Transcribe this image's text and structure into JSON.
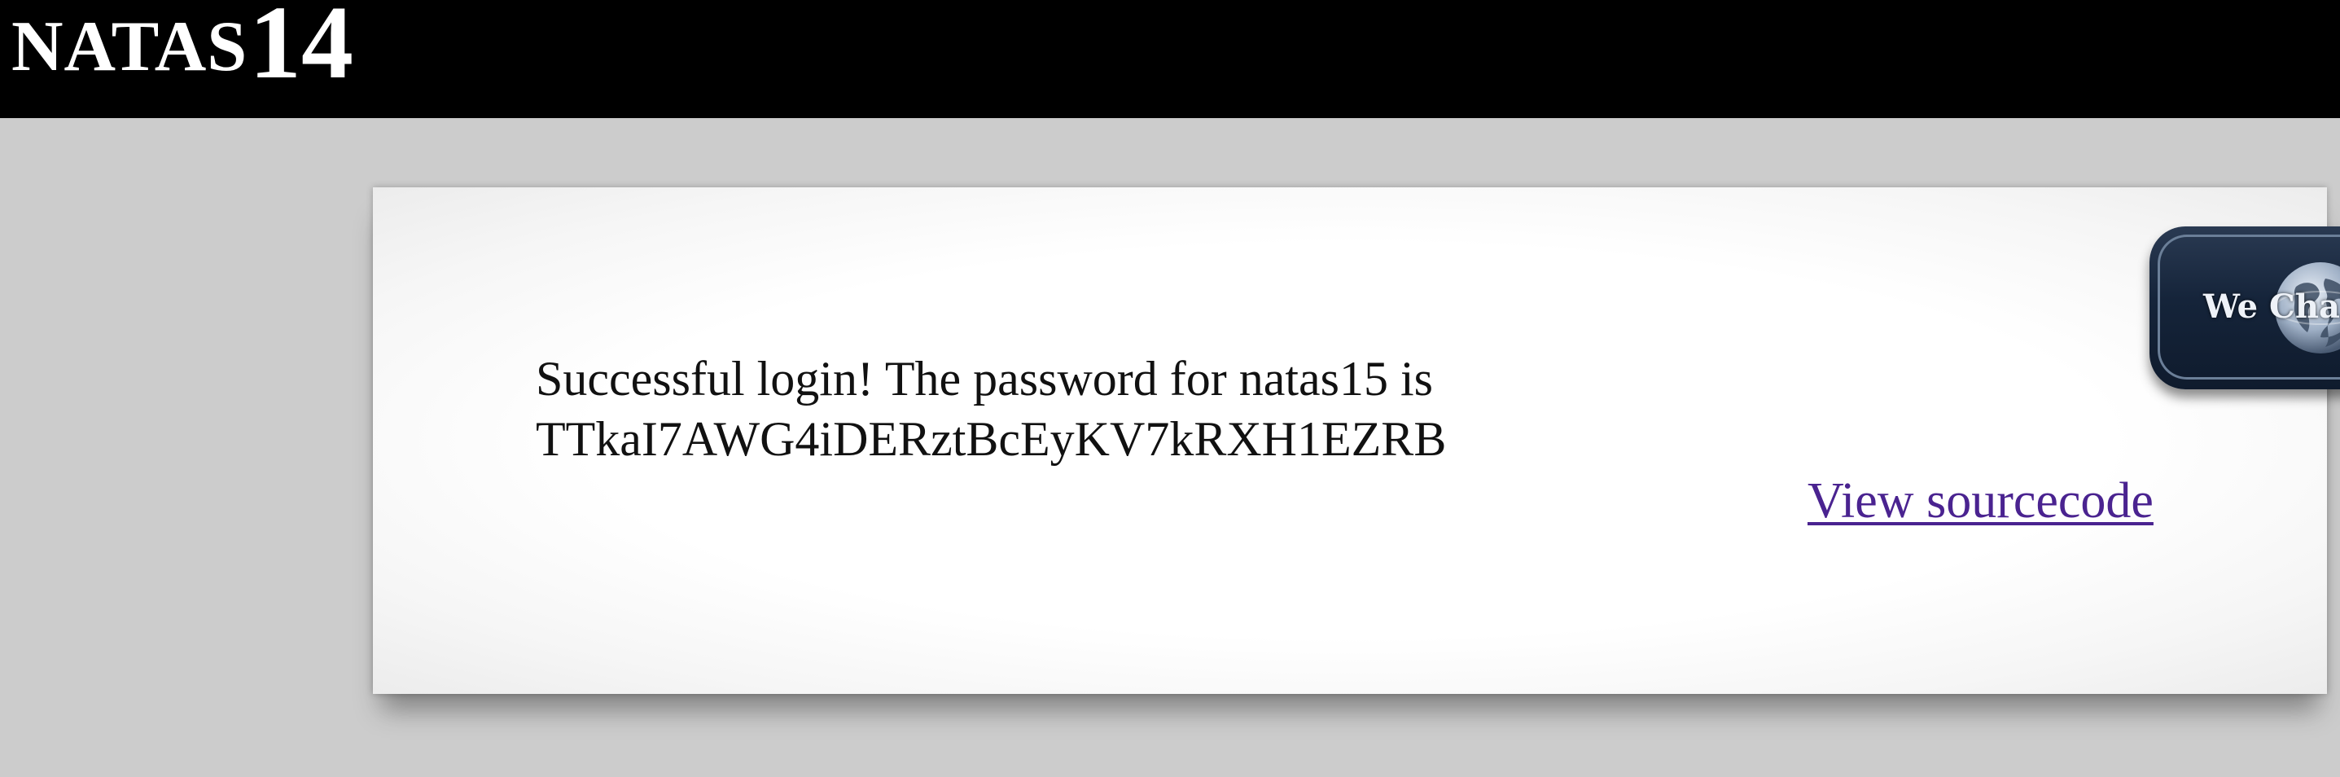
{
  "header": {
    "title_word": "NATAS",
    "title_number": "14"
  },
  "content": {
    "message_line1": "Successful login! The password for natas15 is",
    "message_line2": "TTkaI7AWG4iDERztBcEyKV7kRXH1EZRB",
    "view_source_link": "View sourcecode"
  },
  "wechall_badge": {
    "text": "We Chall",
    "icon": "globe-icon"
  },
  "colors": {
    "header_bg": "#000000",
    "page_bg": "#cccccc",
    "link": "#4a2390",
    "badge_bg": "#15243a"
  }
}
